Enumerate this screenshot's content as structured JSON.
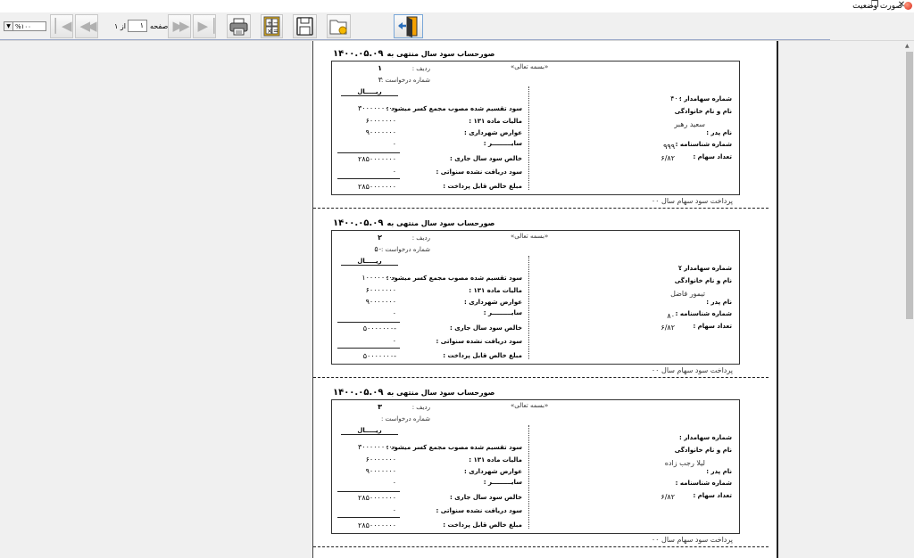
{
  "window": {
    "title": "صورت وضعیت",
    "restore_glyph": "❐",
    "close_glyph": "✕"
  },
  "toolbar": {
    "zoom_value": "%۱۰۰",
    "page_label": "صفحه",
    "page_current": "۱",
    "of_label": "از",
    "page_total": "۱"
  },
  "icons": [
    "first-page-icon",
    "prev-page-icon",
    "next-page-icon",
    "last-page-icon",
    "printer-icon",
    "calculator-icon",
    "floppy-disk-icon",
    "folder-icon",
    "exit-door-icon"
  ],
  "report": {
    "heading": "صورحساب سود سال منتهی به",
    "date": "۱۴۰۰.۰۵.۰۹",
    "basmala": "«بسمه تعالی»",
    "row_label": "ردیف :",
    "request_label": "شماره درخواست :",
    "currency": "ریـــــال",
    "labels": {
      "dividend": "سود تقسیم شده مصوب مجمع  کسر میشود :",
      "tax": "مالیات ماده ۱۳۱ :",
      "municipal": "عوارض شهرداری :",
      "other": "سایـــــــــر :",
      "net": "خالص سود سال جاری :",
      "received": "سود دریافت نشده سنواتی :",
      "payable": "مبلغ خالص قابل پرداخت :",
      "holder_no": "شماره سهامدار :",
      "name": "نام و نام خانوادگی",
      "father": "نام پدر :",
      "id_no": "شماره شناسنامه :",
      "shares": "تعداد سهام :"
    },
    "footer": "پرداخت سود سهام سال ۰۰",
    "statements": [
      {
        "row": "۱",
        "request": "۳",
        "dividend": "۳۰۰۰۰۰۰۰۰۰",
        "tax": "۶۰۰۰۰۰۰۰",
        "municipal": "۹۰۰۰۰۰۰۰",
        "other": "۰",
        "net": "۲۸۵۰۰۰۰۰۰۰",
        "received": "۰",
        "payable": "۲۸۵۰۰۰۰۰۰۰",
        "holder_no": "۴۰۰",
        "name": "سعید رهبر",
        "id_no": "۹۹۹",
        "shares": "۶/۸۲"
      },
      {
        "row": "۲",
        "request": "۵۰",
        "dividend": "۱۰۰۰۰۰۰۰۰",
        "tax": "۶۰۰۰۰۰۰۰",
        "municipal": "۹۰۰۰۰۰۰۰",
        "other": "۰",
        "net": "-۵۰۰۰۰۰۰۰",
        "received": "۰",
        "payable": "-۵۰۰۰۰۰۰۰",
        "holder_no": "۲",
        "name": "تیمور فاضل",
        "id_no": "۸۰",
        "shares": "۶/۸۲"
      },
      {
        "row": "۳",
        "request": "",
        "dividend": "۳۰۰۰۰۰۰۰۰۰",
        "tax": "۶۰۰۰۰۰۰۰",
        "municipal": "۹۰۰۰۰۰۰۰",
        "other": "۰",
        "net": "۲۸۵۰۰۰۰۰۰۰",
        "received": "۰",
        "payable": "۲۸۵۰۰۰۰۰۰۰",
        "holder_no": "",
        "name": "لیلا رجب زاده",
        "id_no": "",
        "shares": "۶/۸۲"
      }
    ]
  }
}
